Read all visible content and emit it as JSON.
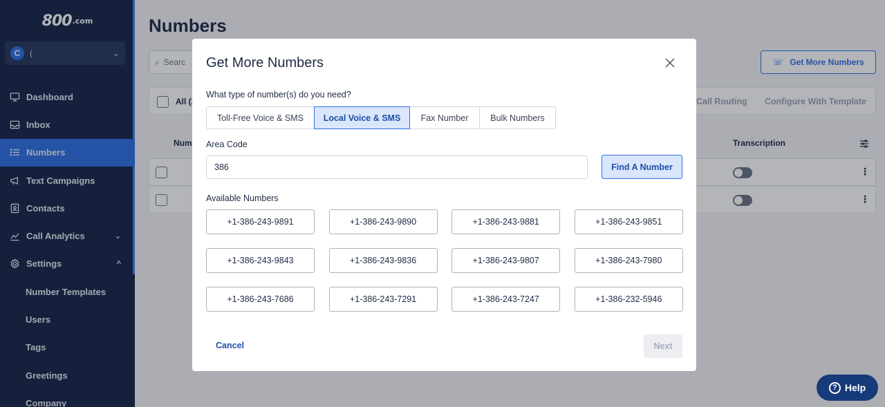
{
  "sidebar": {
    "logo_main": "800",
    "logo_suffix": ".com",
    "account_initial": "C",
    "account_name": "(",
    "items": [
      {
        "label": "Dashboard",
        "icon": "monitor-icon"
      },
      {
        "label": "Inbox",
        "icon": "inbox-icon"
      },
      {
        "label": "Numbers",
        "icon": "list-icon",
        "active": true
      },
      {
        "label": "Text Campaigns",
        "icon": "megaphone-icon"
      },
      {
        "label": "Contacts",
        "icon": "contact-card-icon"
      },
      {
        "label": "Call Analytics",
        "icon": "chart-line-icon",
        "caret": "⌄"
      },
      {
        "label": "Settings",
        "icon": "gear-icon",
        "caret": "^"
      },
      {
        "label": "Number Templates"
      },
      {
        "label": "Users"
      },
      {
        "label": "Tags"
      },
      {
        "label": "Greetings"
      },
      {
        "label": "Company"
      }
    ]
  },
  "main": {
    "title": "Numbers",
    "search_placeholder": "Searc",
    "get_more_label": "Get More Numbers",
    "toolbar": {
      "all_label": "All (2",
      "actions": [
        "Call Routing",
        "Configure With Template"
      ]
    },
    "table_headers": {
      "number": "Num",
      "transcription": "Transcription"
    }
  },
  "modal": {
    "title": "Get More Numbers",
    "question": "What type of number(s) do you need?",
    "types": [
      "Toll-Free Voice & SMS",
      "Local Voice & SMS",
      "Fax Number",
      "Bulk Numbers"
    ],
    "selected_type": "Local Voice & SMS",
    "area_code_label": "Area Code",
    "area_code_value": "386",
    "find_label": "Find A Number",
    "available_label": "Available Numbers",
    "numbers": [
      "+1-386-243-9891",
      "+1-386-243-9890",
      "+1-386-243-9881",
      "+1-386-243-9851",
      "+1-386-243-9843",
      "+1-386-243-9836",
      "+1-386-243-9807",
      "+1-386-243-7980",
      "+1-386-243-7686",
      "+1-386-243-7291",
      "+1-386-243-7247",
      "+1-386-232-5946"
    ],
    "cancel_label": "Cancel",
    "next_label": "Next"
  },
  "help_label": "Help",
  "colors": {
    "sidebar": "#162447",
    "accent": "#2f6fe4",
    "selected_fill": "#d9e6fb"
  }
}
